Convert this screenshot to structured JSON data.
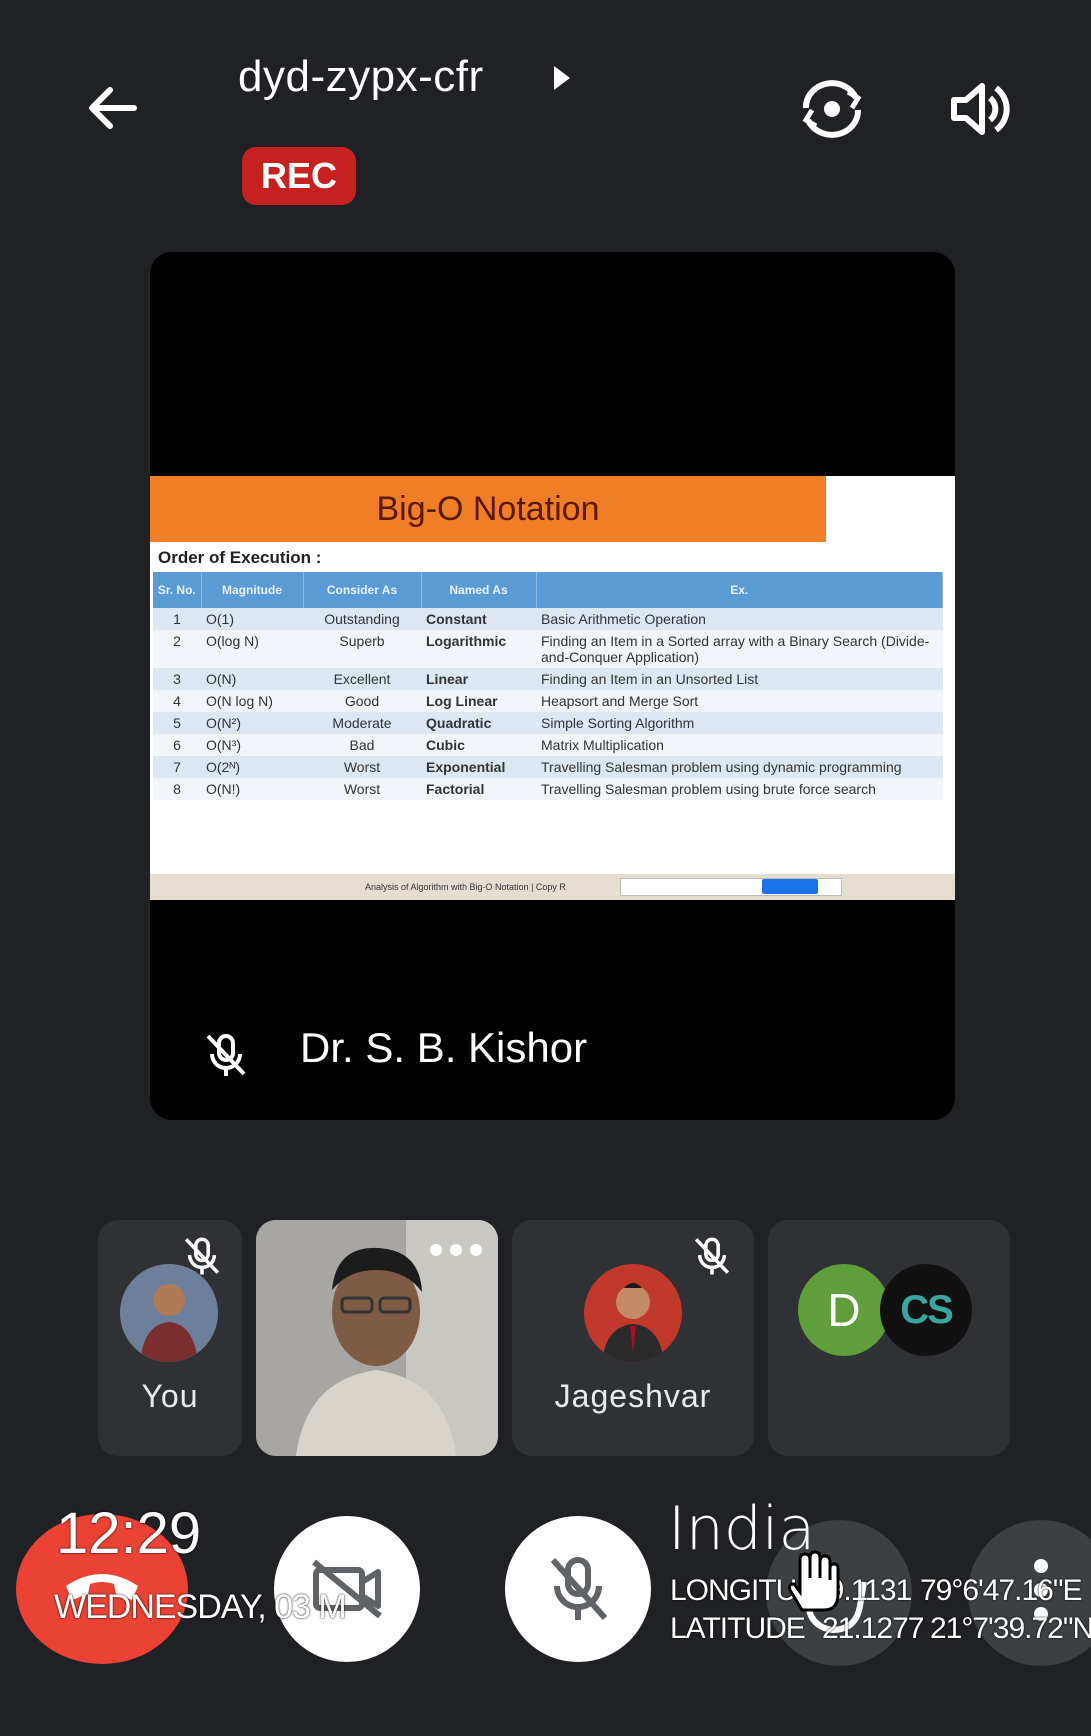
{
  "header": {
    "meeting_code": "dyd-zypx-cfr",
    "rec_badge": "REC",
    "icons": [
      "back-arrow-icon",
      "play-triangle-icon",
      "switch-camera-icon",
      "speaker-icon"
    ]
  },
  "presenter": {
    "name": "Dr. S. B. Kishor",
    "slide": {
      "title": "Big-O Notation",
      "subtitle": "Order of Execution :",
      "columns": [
        "Sr. No.",
        "Magnitude",
        "Consider As",
        "Named As",
        "Ex."
      ],
      "rows": [
        [
          "1",
          "O(1)",
          "Outstanding",
          "Constant",
          "Basic Arithmetic Operation"
        ],
        [
          "2",
          "O(log N)",
          "Superb",
          "Logarithmic",
          "Finding an Item in a Sorted array with a Binary Search (Divide-and-Conquer Application)"
        ],
        [
          "3",
          "O(N)",
          "Excellent",
          "Linear",
          "Finding an Item in an Unsorted List"
        ],
        [
          "4",
          "O(N log N)",
          "Good",
          "Log Linear",
          "Heapsort and Merge Sort"
        ],
        [
          "5",
          "O(N²)",
          "Moderate",
          "Quadratic",
          "Simple Sorting Algorithm"
        ],
        [
          "6",
          "O(N³)",
          "Bad",
          "Cubic",
          "Matrix Multiplication"
        ],
        [
          "7",
          "O(2ᴺ)",
          "Worst",
          "Exponential",
          "Travelling Salesman problem using dynamic programming"
        ],
        [
          "8",
          "O(N!)",
          "Worst",
          "Factorial",
          "Travelling Salesman problem using brute force search"
        ]
      ],
      "footer": "Analysis of Algorithm with Big-O Notation | Copy R"
    }
  },
  "participants": [
    {
      "name": "You",
      "muted": true
    },
    {
      "name": "",
      "muted": false,
      "video": true
    },
    {
      "name": "Jageshvar",
      "muted": true
    },
    {
      "name": "",
      "avatar_letter": "D",
      "extra_avatar": "CS"
    }
  ],
  "controls": [
    "hangup-button",
    "camera-toggle-button",
    "mic-toggle-button",
    "raise-hand-button",
    "more-options-button"
  ],
  "overlay": {
    "time": "12:29",
    "date": "WEDNESDAY, 03 M",
    "country": "India",
    "longitude_label": "LONGITUDE",
    "longitude_dec": "79.1131",
    "longitude_dms": "79°6'47.16\"E",
    "latitude_label": "LATITUDE",
    "latitude_dec": "21.1277",
    "latitude_dms": "21°7'39.72\"N"
  },
  "colors": {
    "background": "#202124",
    "rec_red": "#c5221f",
    "hangup_red": "#ea4335",
    "slide_banner": "#f07e26",
    "table_header": "#5b9bd5",
    "avatar_green": "#5f9e3a"
  }
}
